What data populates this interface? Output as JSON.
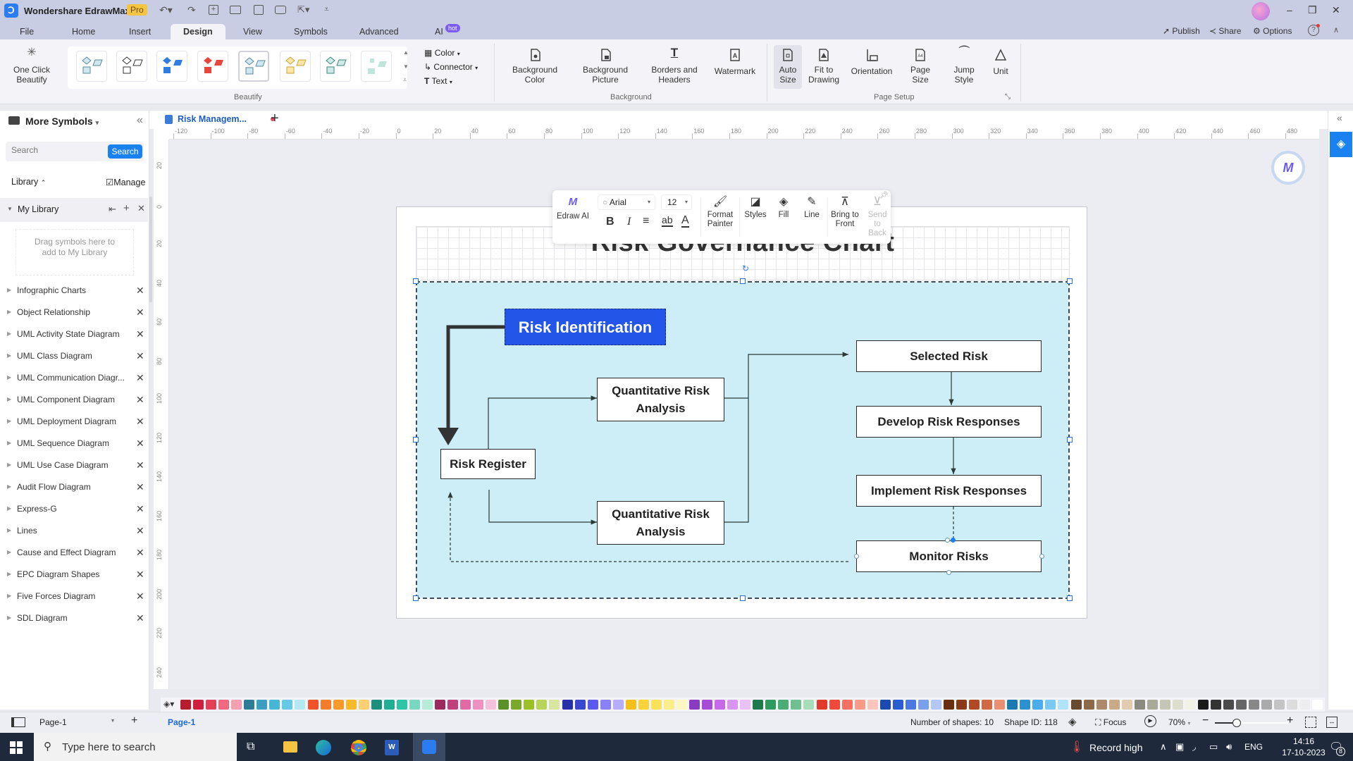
{
  "app": {
    "title": "Wondershare EdrawMax",
    "badge": "Pro",
    "quick_access_icons": [
      "undo-icon",
      "redo-icon",
      "new-icon",
      "open-icon",
      "save-icon",
      "print-icon",
      "export-icon",
      "customize-icon"
    ]
  },
  "window_controls": {
    "minimize": "–",
    "restore": "❐",
    "close": "✕"
  },
  "menu": {
    "tabs": [
      "File",
      "Home",
      "Insert",
      "Design",
      "View",
      "Symbols",
      "Advanced",
      "AI"
    ],
    "active": "Design",
    "ai_badge": "hot",
    "right": {
      "publish": "Publish",
      "share": "Share",
      "options": "Options"
    }
  },
  "ribbon": {
    "one_click_beautify": "One Click Beautify",
    "beautify_group": "Beautify",
    "color": "Color",
    "connector": "Connector",
    "text": "Text",
    "background_group": "Background",
    "background_color": "Background Color",
    "background_picture": "Background Picture",
    "borders_headers": "Borders and Headers",
    "watermark": "Watermark",
    "page_setup_group": "Page Setup",
    "auto_size": "Auto Size",
    "fit_to_drawing": "Fit to Drawing",
    "orientation": "Orientation",
    "page_size": "Page Size",
    "jump_style": "Jump Style",
    "unit": "Unit"
  },
  "left_panel": {
    "title": "More Symbols",
    "search_placeholder": "Search",
    "search_button": "Search",
    "library_label": "Library",
    "manage_label": "Manage",
    "my_library": "My Library",
    "drop_hint": "Drag symbols here to add to My Library",
    "libraries": [
      "Infographic Charts",
      "Object Relationship",
      "UML Activity State Diagram",
      "UML Class Diagram",
      "UML Communication Diagr...",
      "UML Component Diagram",
      "UML Deployment Diagram",
      "UML Sequence Diagram",
      "UML Use Case Diagram",
      "Audit Flow Diagram",
      "Express-G",
      "Lines",
      "Cause and Effect Diagram",
      "EPC Diagram Shapes",
      "Five Forces Diagram",
      "SDL Diagram"
    ]
  },
  "doc_tab": {
    "name": "Risk Managem...",
    "unsaved": true
  },
  "rulers": {
    "h_ticks": [
      "-120",
      "-100",
      "-80",
      "-60",
      "-40",
      "-20",
      "0",
      "20",
      "40",
      "60",
      "80",
      "100",
      "120",
      "140",
      "160",
      "180",
      "200",
      "220",
      "240",
      "260",
      "280",
      "300",
      "320",
      "340",
      "360",
      "380",
      "400",
      "420",
      "440",
      "460",
      "480"
    ],
    "v_ticks": [
      "20",
      "0",
      "20",
      "40",
      "60",
      "80",
      "100",
      "120",
      "140",
      "160",
      "180",
      "200",
      "220",
      "240"
    ]
  },
  "float_toolbar": {
    "edraw_ai": "Edraw AI",
    "font": "Arial",
    "size": "12",
    "format_painter": "Format Painter",
    "styles": "Styles",
    "fill": "Fill",
    "line": "Line",
    "bring_front": "Bring to Front",
    "send_back": "Send to Back"
  },
  "diagram": {
    "title": "Risk Governance Chart",
    "background": "#cdeef6",
    "nodes": {
      "risk_identification": "Risk Identification",
      "risk_register": "Risk Register",
      "qra_top": "Quantitative Risk Analysis",
      "qra_bottom": "Quantitative Risk Analysis",
      "selected_risk": "Selected Risk",
      "develop": "Develop Risk Responses",
      "implement": "Implement Risk Responses",
      "monitor": "Monitor Risks"
    },
    "accent": "#2255e8"
  },
  "palette": [
    "#b71c2c",
    "#d01f3c",
    "#e0405a",
    "#ee6a80",
    "#f4a0b0",
    "#2e7d96",
    "#3a9fc0",
    "#45b6d6",
    "#64c9e4",
    "#b5e6f4",
    "#f0522a",
    "#f57c2c",
    "#f99b2a",
    "#fbb92a",
    "#fbd070",
    "#1a8f7a",
    "#1fae92",
    "#2cc6a6",
    "#78d8c0",
    "#b4ecd8",
    "#9c2a5c",
    "#c0407e",
    "#e06aa6",
    "#f090c0",
    "#f5c0da",
    "#5a8f2a",
    "#7aa82a",
    "#9cc02a",
    "#b8d45a",
    "#d8e6a0",
    "#2830a8",
    "#3a48d0",
    "#5a5af0",
    "#8a80f8",
    "#b6acfc",
    "#f5c018",
    "#f8d43a",
    "#fbe25a",
    "#fcee8a",
    "#fcf6c0",
    "#8a3ac0",
    "#a84ad8",
    "#c46ae8",
    "#d896f0",
    "#e8c0f6",
    "#1e7a4a",
    "#2e9a5e",
    "#4aae74",
    "#6ec090",
    "#a6dcb8",
    "#e03a2a",
    "#f04a3a",
    "#f87060",
    "#fc9a8a",
    "#fcc6bc",
    "#1a4ab0",
    "#2a5ed0",
    "#4a7ae0",
    "#7aa0ec",
    "#b4c8f6",
    "#6a2e10",
    "#8a3a14",
    "#b04a24",
    "#d06a44",
    "#e89070",
    "#1a7ab0",
    "#2a90d0",
    "#4aacec",
    "#7ac8f4",
    "#b0e2fa",
    "#6a4a2e",
    "#8a6a4a",
    "#aa8a6a",
    "#c8aa8a",
    "#e2ccb0",
    "#8a8a80",
    "#aaaa9a",
    "#c6c6b6",
    "#dedece",
    "#f2f2e6",
    "#1a1a1a",
    "#333333",
    "#4a4a4a",
    "#666666",
    "#888888",
    "#aaaaaa",
    "#c4c4c4",
    "#dcdcdc",
    "#eeeeee",
    "#ffffff"
  ],
  "status": {
    "page_select": "Page-1",
    "page_tab": "Page-1",
    "shape_count": "Number of shapes: 10",
    "shape_id": "Shape ID: 118",
    "focus": "Focus",
    "zoom": "70%",
    "zoom_fraction": 0.3
  },
  "taskbar": {
    "search_placeholder": "Type here to search",
    "weather": "Record high",
    "lang": "ENG",
    "time": "14:16",
    "date": "17-10-2023",
    "notifications": "8"
  }
}
